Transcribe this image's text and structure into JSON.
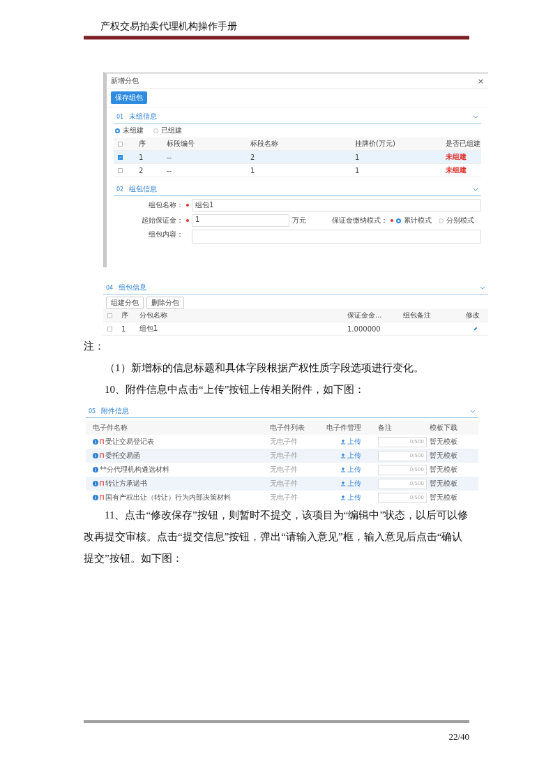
{
  "header": {
    "title": "产权交易拍卖代理机构操作手册"
  },
  "dialog": {
    "title": "新增分包",
    "close": "×",
    "save_button": "保存组包",
    "section_1": {
      "number": "01",
      "title": "未组信息"
    },
    "filters": [
      {
        "label": "未组建",
        "selected": true
      },
      {
        "label": "已组建",
        "selected": false
      }
    ],
    "table": {
      "all_checked": false,
      "columns": [
        "序",
        "标段编号",
        "标段名称",
        "挂牌价(万元)",
        "是否已组建"
      ],
      "rows": [
        {
          "checked": true,
          "cells": [
            "1",
            "--",
            "2",
            "1",
            "未组建"
          ]
        },
        {
          "checked": false,
          "cells": [
            "2",
            "--",
            "1",
            "1",
            "未组建"
          ]
        }
      ]
    },
    "section_2": {
      "number": "02",
      "title": "组包信息"
    },
    "form": {
      "name_label": "组包名称：",
      "name_value": "组包1",
      "deposit_label": "起始保证金：",
      "deposit_value": "1",
      "deposit_unit": "万元",
      "mode_label": "保证金缴纳模式：",
      "modes": [
        {
          "label": "累计模式",
          "selected": true
        },
        {
          "label": "分别模式",
          "selected": false
        }
      ],
      "content_label": "组包内容："
    }
  },
  "package_panel": {
    "section": {
      "number": "04",
      "title": "组包信息"
    },
    "buttons": [
      "组建分包",
      "删除分包"
    ],
    "table": {
      "all_checked": false,
      "columns": [
        "序",
        "分包名称",
        "保证金金...",
        "组包备注",
        "修改"
      ],
      "rows": [
        {
          "checked": false,
          "cells": [
            "1",
            "组包1",
            "1.000000",
            ""
          ]
        }
      ]
    }
  },
  "paragraphs": [
    {
      "kind": "plain",
      "text": "注："
    },
    {
      "kind": "indent",
      "text": "（1）新增标的信息标题和具体字段根据产权性质字段选项进行变化。"
    },
    {
      "kind": "indent",
      "text": "10、附件信息中点击“上传”按钮上传相关附件，如下图："
    }
  ],
  "attachments": {
    "section": {
      "number": "05",
      "title": "附件信息"
    },
    "columns": [
      "电子件名称",
      "电子件列表",
      "电子件管理",
      "备注",
      "模板下载"
    ],
    "rows": [
      {
        "marked": true,
        "name": "受让交易登记表",
        "list": "无电子件",
        "upload": "上传",
        "counter": "0/500",
        "template": "暂无模板"
      },
      {
        "marked": true,
        "name": "委托交易函",
        "list": "无电子件",
        "upload": "上传",
        "counter": "0/500",
        "template": "暂无模板"
      },
      {
        "marked": false,
        "name": "**分代理机构遴选材料",
        "list": "无电子件",
        "upload": "上传",
        "counter": "0/500",
        "template": "暂无模板"
      },
      {
        "marked": true,
        "name": "转让方承诺书",
        "list": "无电子件",
        "upload": "上传",
        "counter": "0/500",
        "template": "暂无模板"
      },
      {
        "marked": true,
        "name": "国有产权出让（转让）行为内部决策材料",
        "list": "无电子件",
        "upload": "上传",
        "counter": "0/500",
        "template": "暂无模板"
      }
    ]
  },
  "closing": [
    {
      "kind": "indent",
      "text": "11、点击“修改保存”按钮，则暂时不提交，该项目为“编辑中”状态，以后可以修改再提交审核。点击“提交信息”按钮，弹出“请输入意见”框，输入意见后点击“确认提交”按钮。如下图："
    }
  ],
  "footer": {
    "page": "22/40"
  }
}
